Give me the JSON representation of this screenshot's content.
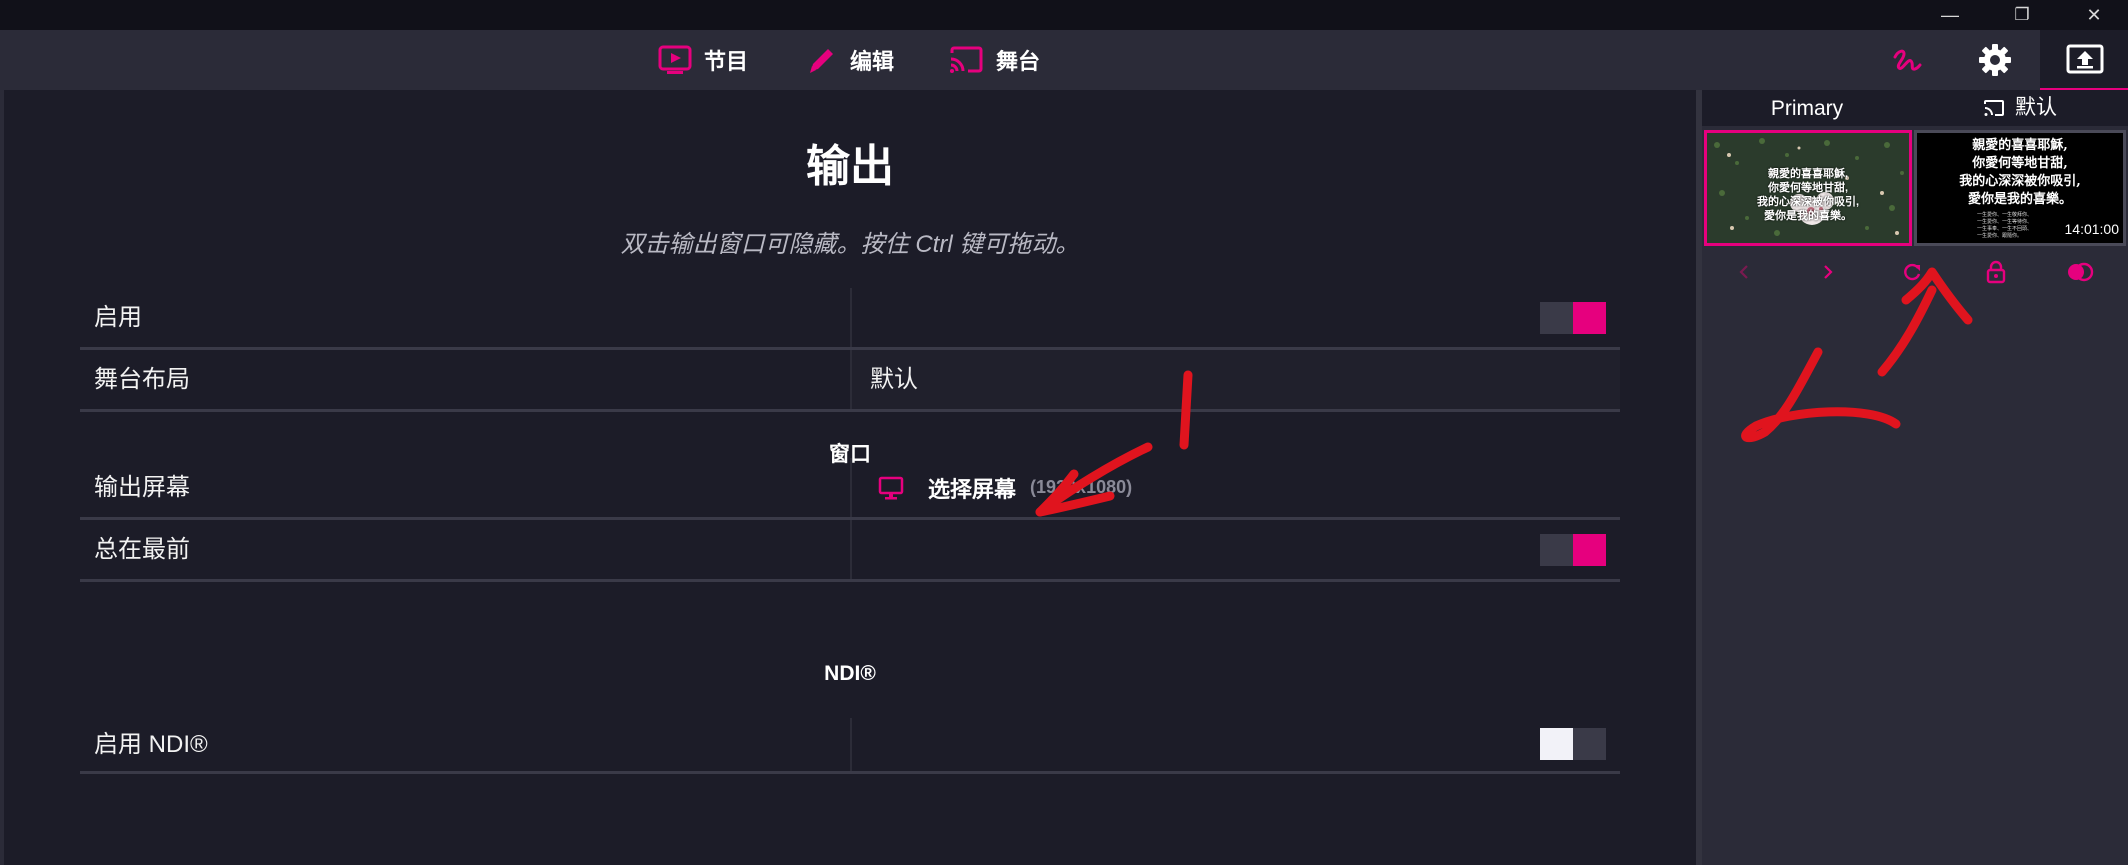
{
  "window_controls": {
    "minimize": "—",
    "maximize": "❐",
    "close": "✕"
  },
  "nav": {
    "tabs": [
      {
        "label": "节目",
        "icon": "tv-play-icon"
      },
      {
        "label": "编辑",
        "icon": "pencil-icon"
      },
      {
        "label": "舞台",
        "icon": "cast-icon"
      }
    ]
  },
  "toolbar": {
    "icons": [
      "draw-squiggle-icon",
      "gear-icon",
      "output-screen-icon"
    ]
  },
  "main": {
    "title": "输出",
    "hint": "双击输出窗口可隐藏。按住 Ctrl 键可拖动。",
    "rows": {
      "enable": {
        "label": "启用",
        "toggle": true
      },
      "stage_layout": {
        "label": "舞台布局",
        "value": "默认"
      },
      "output_screen": {
        "label": "输出屏幕",
        "value": "选择屏幕",
        "resolution": "(1920x1080)"
      },
      "always_on_top": {
        "label": "总在最前",
        "toggle": true
      },
      "ndi_enable": {
        "label": "启用 NDI®",
        "toggle": false
      }
    },
    "sections": {
      "window": "窗口",
      "ndi": "NDI®"
    }
  },
  "sidebar": {
    "tabs": [
      {
        "label": "Primary"
      },
      {
        "label": "默认",
        "icon": "cast-icon"
      }
    ],
    "primary_thumb": {
      "lines": [
        "親愛的喜喜耶穌,",
        "你愛何等地甘甜,",
        "我的心深深被你吸引,",
        "愛你是我的喜樂。"
      ]
    },
    "stage_thumb": {
      "lines": [
        "親愛的喜喜耶穌,",
        "你愛何等地甘甜,",
        "我的心深深被你吸引,",
        "愛你是我的喜樂。"
      ],
      "small_lines": [
        "一生愛你、一生敬拜你、",
        "一生愛你、一生等待你、",
        "一生事奉、一生不回頭、",
        "一生愛你、跟隨你。"
      ],
      "clock": "14:01:00"
    },
    "controls": [
      "chevron-left-icon",
      "chevron-right-icon",
      "refresh-icon",
      "lock-icon",
      "blend-icon"
    ]
  },
  "colors": {
    "accent": "#e6007e",
    "annotation": "#e0141e",
    "bg": "#1c1c28",
    "panel": "#2b2b38"
  }
}
